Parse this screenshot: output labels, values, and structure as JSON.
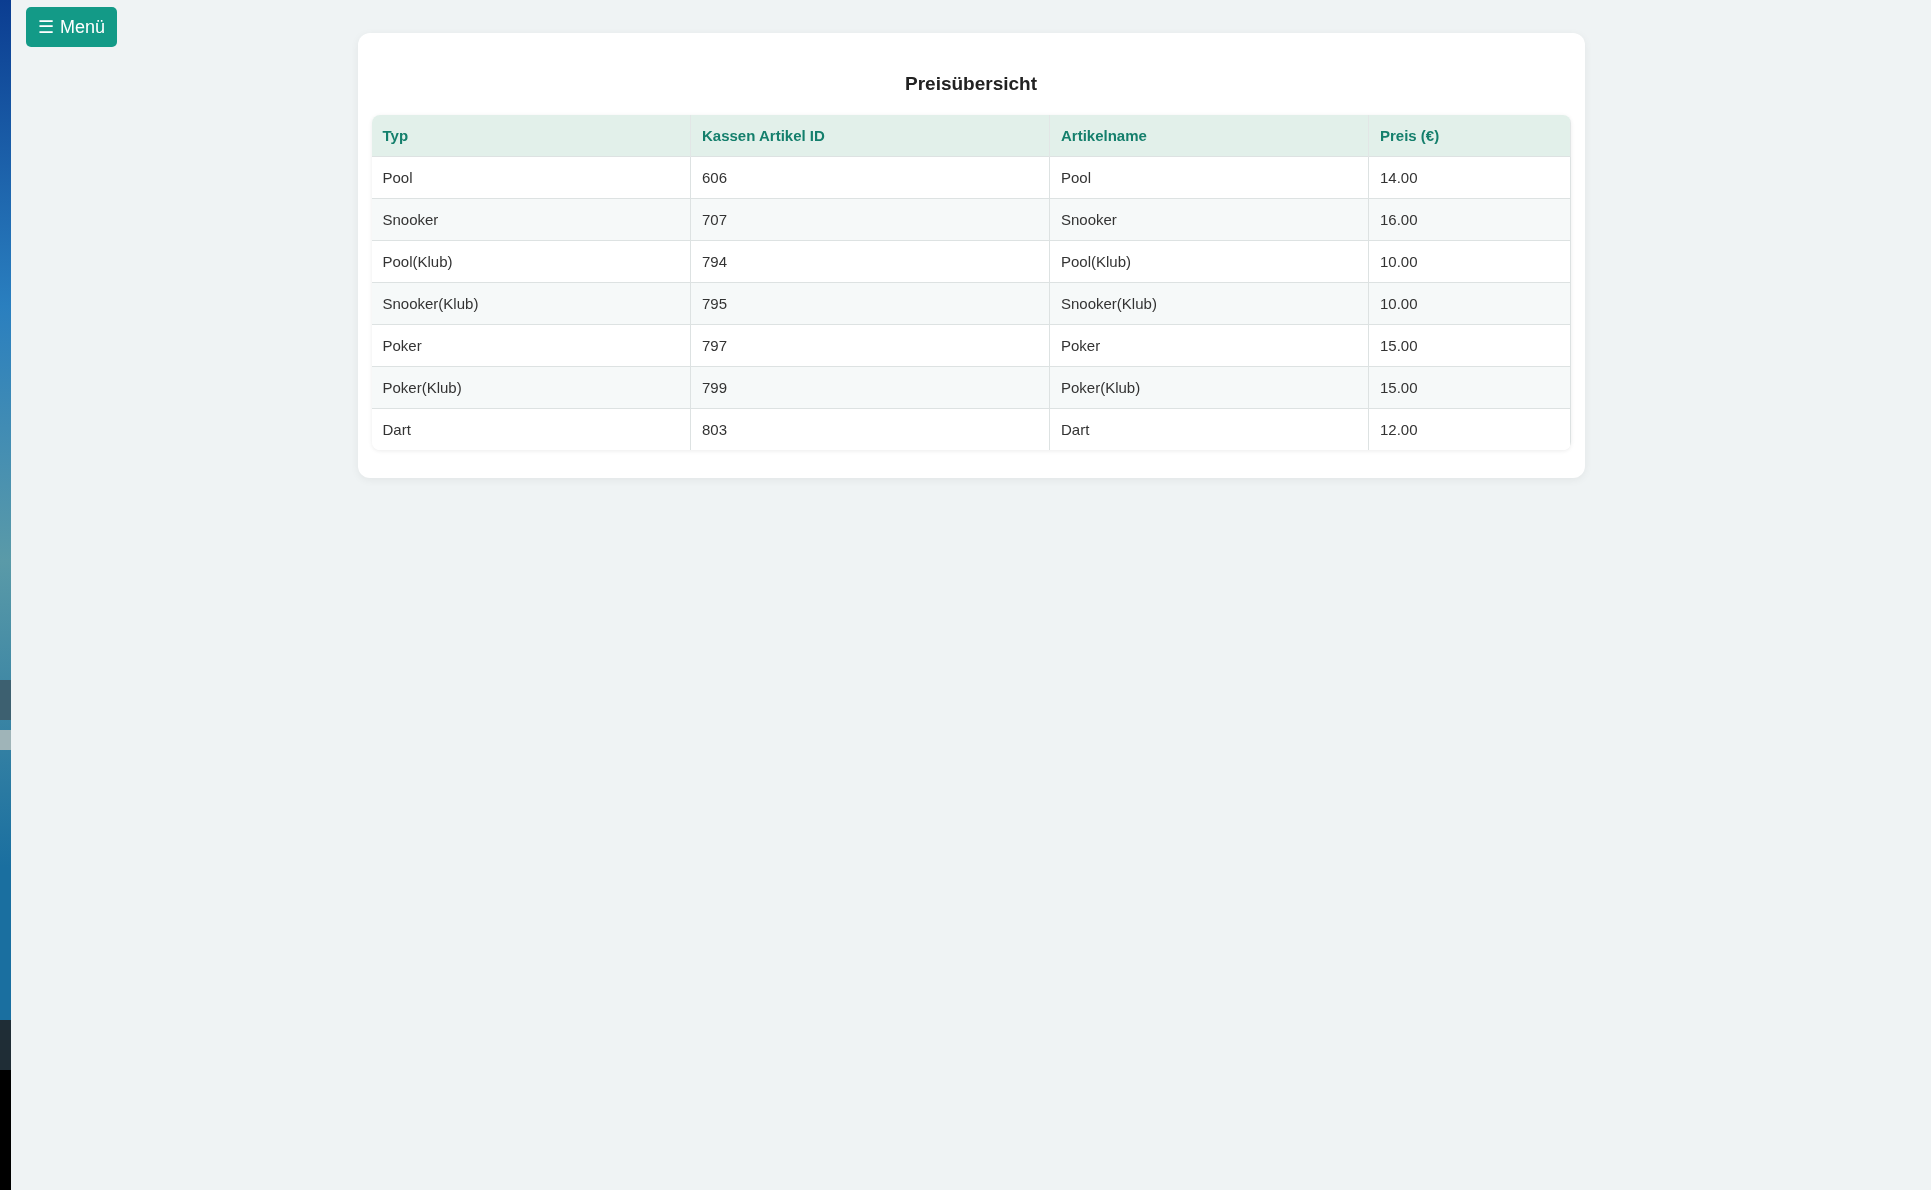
{
  "menu_button": {
    "icon": "☰",
    "label": "Menü"
  },
  "card": {
    "title": "Preisübersicht",
    "table": {
      "columns": [
        "Typ",
        "Kassen Artikel ID",
        "Artikelname",
        "Preis (€)"
      ],
      "rows": [
        [
          "Pool",
          "606",
          "Pool",
          "14.00"
        ],
        [
          "Snooker",
          "707",
          "Snooker",
          "16.00"
        ],
        [
          "Pool(Klub)",
          "794",
          "Pool(Klub)",
          "10.00"
        ],
        [
          "Snooker(Klub)",
          "795",
          "Snooker(Klub)",
          "10.00"
        ],
        [
          "Poker",
          "797",
          "Poker",
          "15.00"
        ],
        [
          "Poker(Klub)",
          "799",
          "Poker(Klub)",
          "15.00"
        ],
        [
          "Dart",
          "803",
          "Dart",
          "12.00"
        ]
      ]
    }
  }
}
